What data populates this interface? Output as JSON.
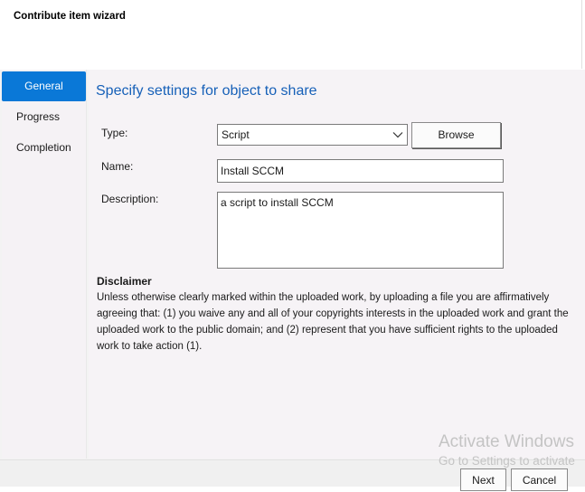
{
  "window": {
    "title": "Contribute item wizard"
  },
  "nav": {
    "items": [
      {
        "label": "General",
        "active": true
      },
      {
        "label": "Progress",
        "active": false
      },
      {
        "label": "Completion",
        "active": false
      }
    ]
  },
  "content": {
    "heading": "Specify settings for object to share",
    "type_label": "Type:",
    "type_value": "Script",
    "browse_label": "Browse",
    "name_label": "Name:",
    "name_value": "Install SCCM",
    "description_label": "Description:",
    "description_value": "a script to install SCCM",
    "disclaimer_title": "Disclaimer",
    "disclaimer_text": "Unless otherwise clearly marked within the uploaded work, by uploading a file you are affirmatively agreeing that: (1) you waive any and all of your copyrights interests in the uploaded work and grant the uploaded work to the public domain; and (2) represent that you have sufficient rights to the uploaded work to take action (1)."
  },
  "footer": {
    "next_label": "Next",
    "cancel_label": "Cancel"
  },
  "watermark": {
    "line1": "Activate Windows",
    "line2": "Go to Settings to activate"
  },
  "colors": {
    "accent": "#0a78d7",
    "heading": "#1660b8",
    "content_bg": "#f6f3f6"
  },
  "icons": {
    "dropdown": "chevron-down-icon"
  }
}
